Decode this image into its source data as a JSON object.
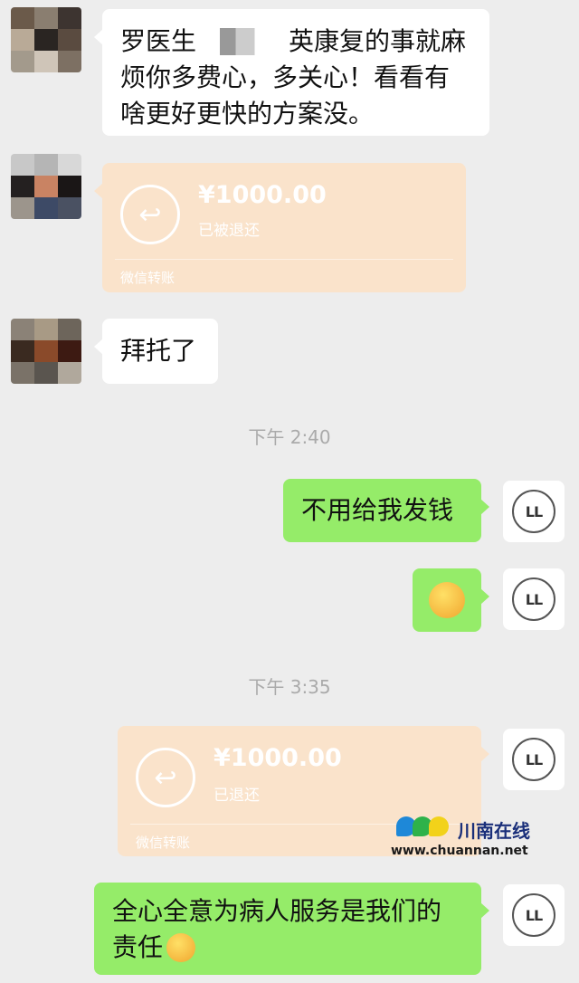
{
  "messages": {
    "m1": {
      "text_line1": "罗医生",
      "text_line1b": "英康复的事就麻",
      "text_line2": "烦你多费心，多关心！看看有",
      "text_line3": "啥更好更快的方案没。"
    },
    "t1": {
      "amount": "¥1000.00",
      "status": "已被退还",
      "footer": "微信转账"
    },
    "m2": {
      "text": "拜托了"
    },
    "time1": "下午 2:40",
    "m3": {
      "text": "不用给我发钱"
    },
    "m4": {
      "emoji": "emoji"
    },
    "time2": "下午 3:35",
    "t2": {
      "amount": "¥1000.00",
      "status": "已退还",
      "footer": "微信转账"
    },
    "m5": {
      "text_line1": "全心全意为病人服务是我们的",
      "text_line2": "责任"
    }
  },
  "self_avatar": {
    "initials": "LL"
  },
  "watermark": {
    "name": "川南在线",
    "url": "www.chuannan.net"
  },
  "colors": {
    "background": "#ededed",
    "green_bubble": "#95ec69",
    "transfer": "#fae3cb",
    "white_bubble": "#ffffff"
  }
}
